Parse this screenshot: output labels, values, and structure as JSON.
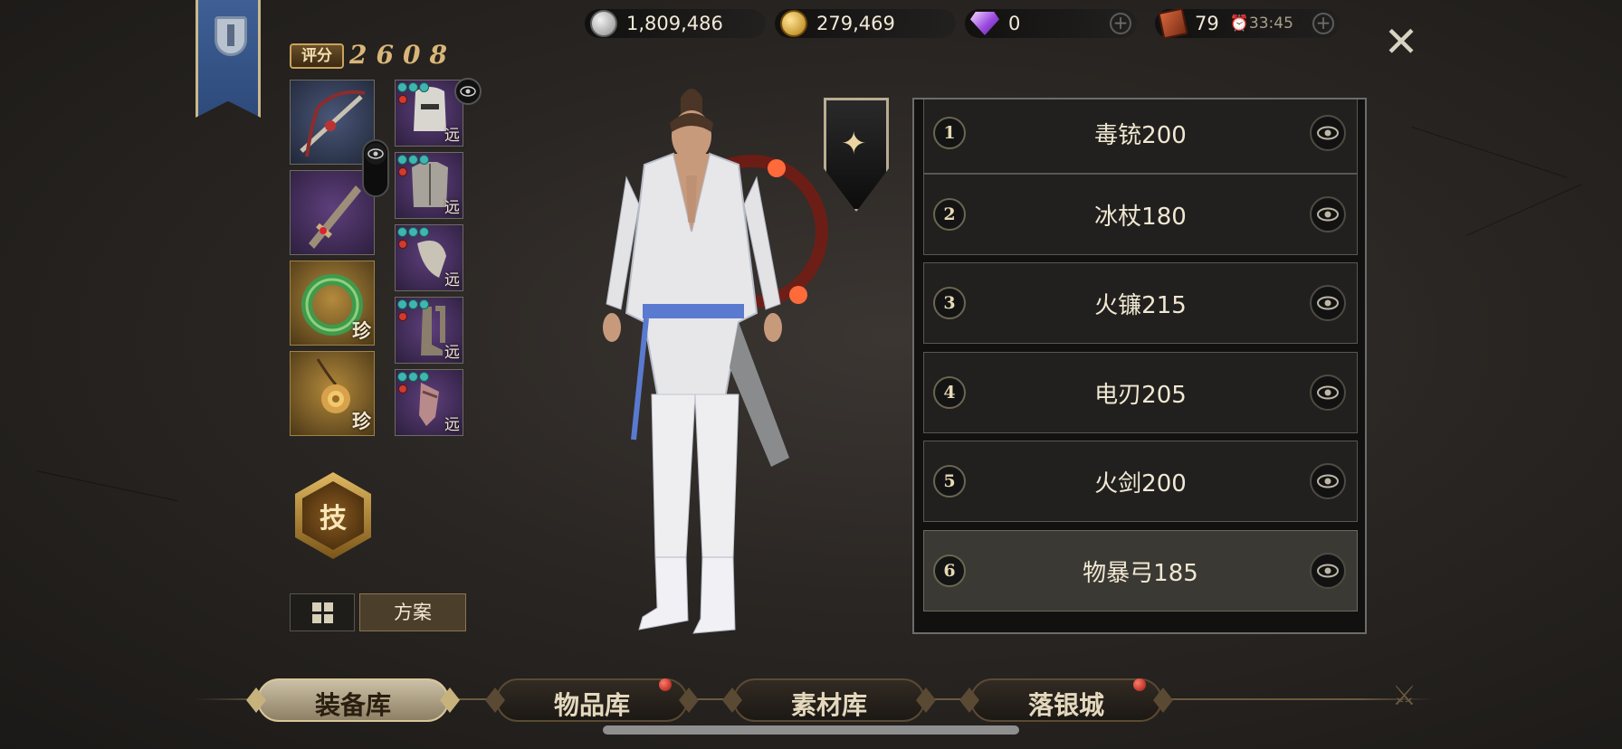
{
  "currencies": {
    "silver": "1,809,486",
    "gold": "279,469",
    "diamond": "0",
    "stamina": "79",
    "stamina_timer": "33:45"
  },
  "score": {
    "label": "评分",
    "value": "2608"
  },
  "equipment": {
    "weapons": [
      {
        "name": "crossbow-slot",
        "tag": ""
      },
      {
        "name": "dagger-slot",
        "tag": ""
      },
      {
        "name": "ring-slot",
        "tag": "珍"
      },
      {
        "name": "necklace-slot",
        "tag": "珍"
      }
    ],
    "armor": [
      {
        "name": "helmet-slot",
        "tag": "远"
      },
      {
        "name": "chest-slot",
        "tag": "远"
      },
      {
        "name": "shoulder-slot",
        "tag": "远"
      },
      {
        "name": "boots-slot",
        "tag": "远"
      },
      {
        "name": "gloves-slot",
        "tag": "远"
      }
    ]
  },
  "skill_button": {
    "label": "技"
  },
  "plan_button": {
    "label": "方案"
  },
  "loadouts": [
    {
      "num": "1",
      "name": "毒铳200"
    },
    {
      "num": "2",
      "name": "冰杖180"
    },
    {
      "num": "3",
      "name": "火镰215"
    },
    {
      "num": "4",
      "name": "电刃205"
    },
    {
      "num": "5",
      "name": "火剑200"
    },
    {
      "num": "6",
      "name": "物暴弓185",
      "selected": true
    }
  ],
  "tabs": [
    {
      "label": "装备库",
      "active": true,
      "badge": false
    },
    {
      "label": "物品库",
      "active": false,
      "badge": true
    },
    {
      "label": "素材库",
      "active": false,
      "badge": false
    },
    {
      "label": "落银城",
      "active": false,
      "badge": true
    }
  ],
  "colors": {
    "accent_gold": "#d9b678",
    "banner_blue": "#3f5f95",
    "badge_red": "#c8261a"
  }
}
